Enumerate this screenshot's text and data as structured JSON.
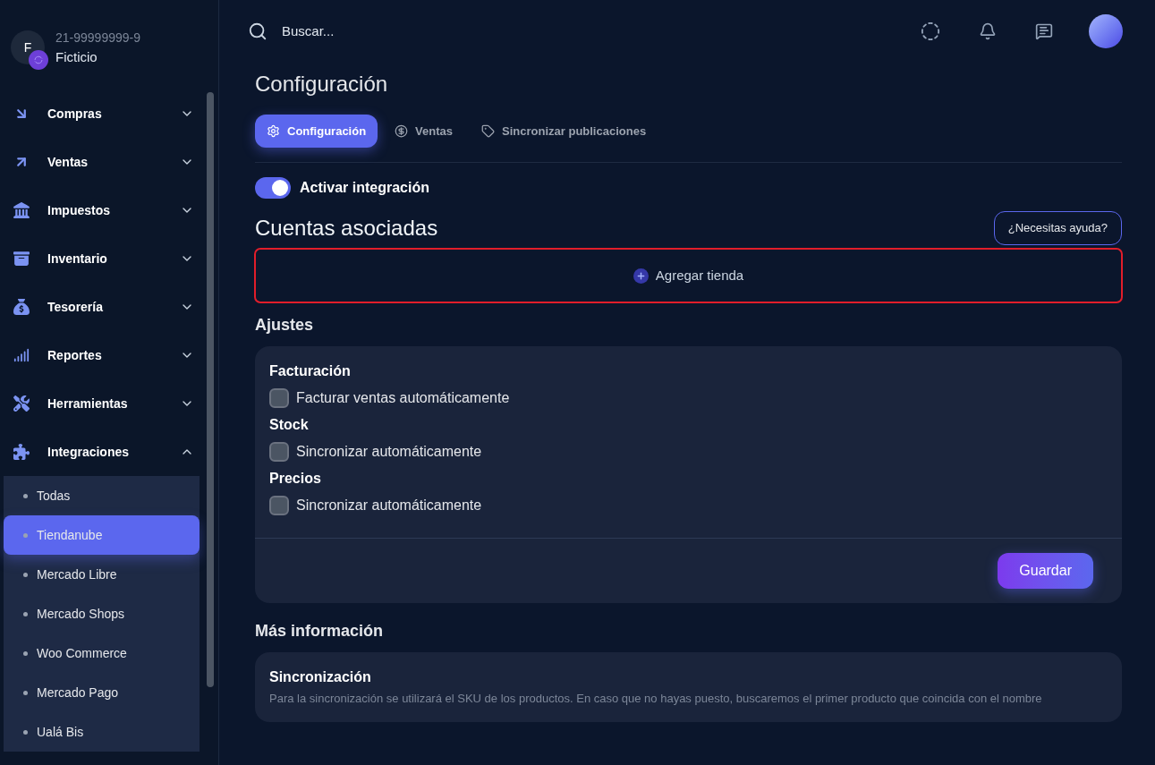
{
  "account": {
    "initial": "F",
    "id": "21-99999999-9",
    "name": "Ficticio"
  },
  "sidebar": {
    "items": [
      {
        "label": "Compras",
        "expanded": false
      },
      {
        "label": "Ventas",
        "expanded": false
      },
      {
        "label": "Impuestos",
        "expanded": false
      },
      {
        "label": "Inventario",
        "expanded": false
      },
      {
        "label": "Tesorería",
        "expanded": false
      },
      {
        "label": "Reportes",
        "expanded": false
      },
      {
        "label": "Herramientas",
        "expanded": false
      },
      {
        "label": "Integraciones",
        "expanded": true,
        "children": [
          {
            "label": "Todas",
            "selected": false
          },
          {
            "label": "Tiendanube",
            "selected": true
          },
          {
            "label": "Mercado Libre",
            "selected": false
          },
          {
            "label": "Mercado Shops",
            "selected": false
          },
          {
            "label": "Woo Commerce",
            "selected": false
          },
          {
            "label": "Mercado Pago",
            "selected": false
          },
          {
            "label": "Ualá Bis",
            "selected": false
          }
        ]
      }
    ]
  },
  "search": {
    "placeholder": "Buscar..."
  },
  "page_title": "Configuración",
  "tabs": [
    {
      "label": "Configuración",
      "selected": true
    },
    {
      "label": "Ventas",
      "selected": false
    },
    {
      "label": "Sincronizar publicaciones",
      "selected": false
    }
  ],
  "integration_toggle": {
    "label": "Activar integración",
    "on": true
  },
  "accounts": {
    "title": "Cuentas asociadas",
    "help_button": "¿Necesitas ayuda?",
    "add_store": {
      "label": "Agregar tienda",
      "highlighted": true
    }
  },
  "settings": {
    "title": "Ajustes",
    "groups": [
      {
        "title": "Facturación",
        "option": "Facturar ventas automáticamente",
        "checked": false
      },
      {
        "title": "Stock",
        "option": "Sincronizar automáticamente",
        "checked": false
      },
      {
        "title": "Precios",
        "option": "Sincronizar automáticamente",
        "checked": false
      }
    ],
    "save_button": "Guardar"
  },
  "more_info": {
    "title": "Más información",
    "card_title": "Sincronización",
    "text": "Para la sincronización se utilizará el SKU de los productos. En caso que no hayas puesto, buscaremos el primer producto que coincida con el nombre"
  }
}
